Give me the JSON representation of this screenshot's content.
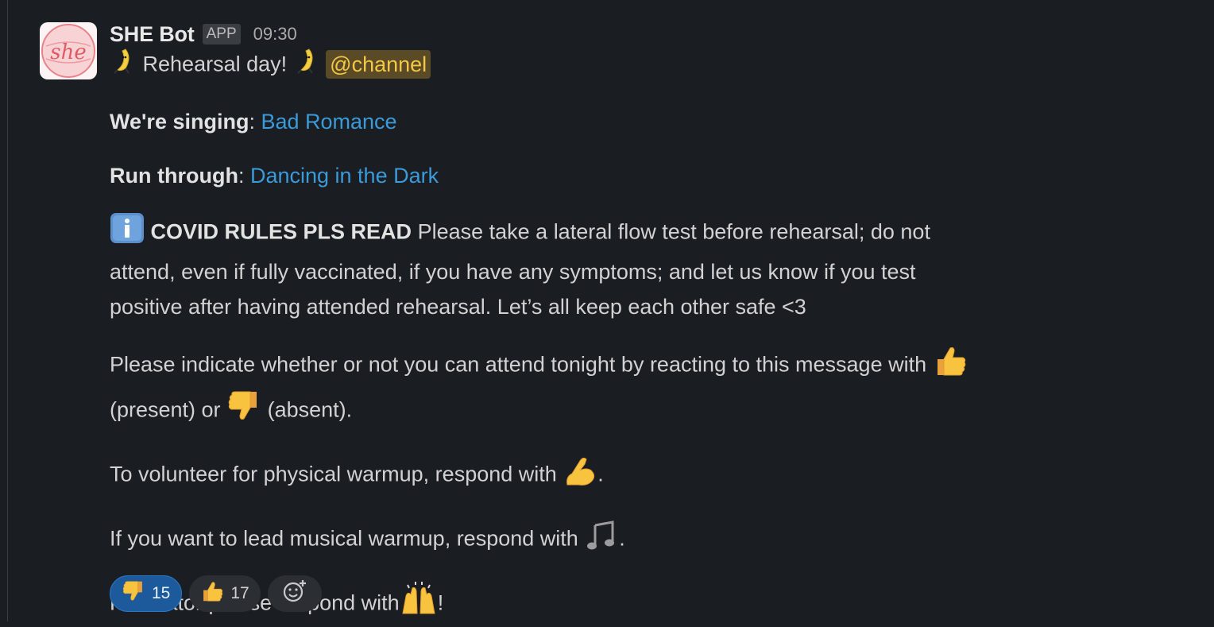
{
  "message": {
    "sender": "SHE Bot",
    "app_badge": "APP",
    "time": "09:30",
    "title_text": "Rehearsal day!",
    "mention": "@channel",
    "singing_label": "We're singing",
    "singing_song": "Bad Romance",
    "runthrough_label": "Run through",
    "runthrough_song": "Dancing in the Dark",
    "covid_heading": "COVID RULES PLS READ",
    "covid_line1": "Please take a lateral flow test before rehearsal; do not",
    "covid_line2": "attend, even if fully vaccinated, if you have any symptoms; and let us know if you test",
    "covid_line3": "positive after having attended rehearsal. Let’s all keep each other safe <3",
    "attend_line1": "Please indicate whether or not you can attend tonight by reacting to this message with",
    "attend_present": "(present) or",
    "attend_absent": "(absent).",
    "warmup_physical": "To volunteer for physical warmup, respond with",
    "warmup_musical": "If you want to lead musical warmup, respond with",
    "facilitator": "Facilitator please respond with",
    "avatar_text": "she"
  },
  "reactions": [
    {
      "icon": "thumbs-down-icon",
      "count": "15",
      "active": true
    },
    {
      "icon": "thumbs-up-icon",
      "count": "17",
      "active": false
    }
  ],
  "colors": {
    "background": "#1a1d21",
    "link": "#3b9ad9",
    "mention_bg": "#5a4a26",
    "mention_text": "#f2c744",
    "reaction_active": "#1d5a9c"
  }
}
